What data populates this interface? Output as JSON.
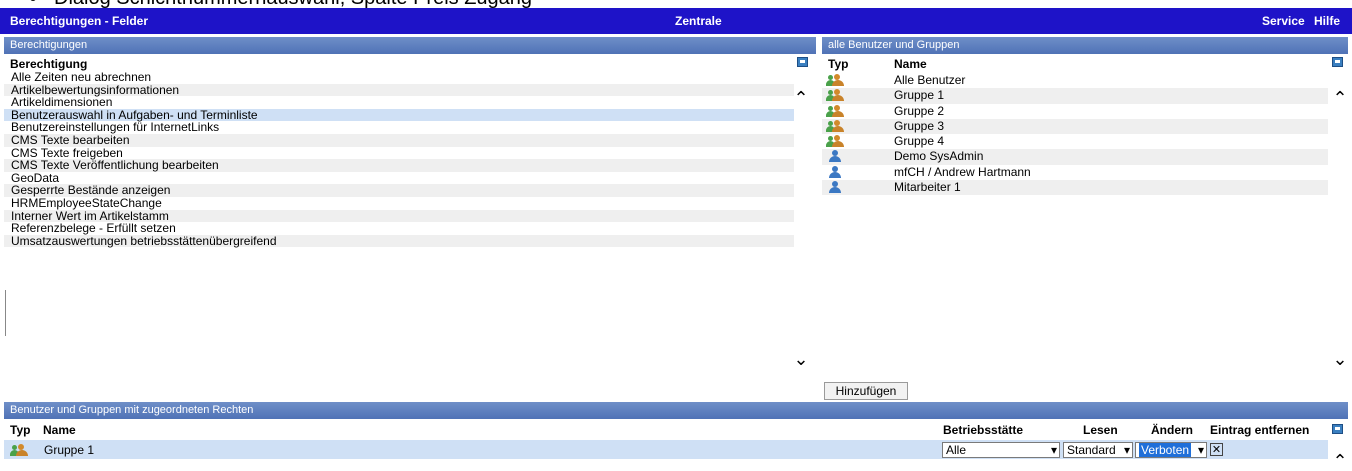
{
  "caption": "Dialog Schichtnummernauswahl, Spalte Preis Zugang",
  "titlebar": {
    "title": "Berechtigungen - Felder",
    "center": "Zentrale",
    "service": "Service",
    "help": "Hilfe"
  },
  "left_panel": {
    "section": "Berechtigungen",
    "column": "Berechtigung",
    "items": [
      "Alle Zeiten neu abrechnen",
      "Artikelbewertungsinformationen",
      "Artikeldimensionen",
      "Benutzerauswahl in Aufgaben- und Terminliste",
      "Benutzereinstellungen für InternetLinks",
      "CMS Texte bearbeiten",
      "CMS Texte freigeben",
      "CMS Texte Veröffentlichung bearbeiten",
      "GeoData",
      "Gesperrte Bestände anzeigen",
      "HRMEmployeeStateChange",
      "Interner Wert im Artikelstamm",
      "Referenzbelege - Erfüllt setzen",
      "Umsatzauswertungen betriebsstättenübergreifend"
    ],
    "selected_index": 3
  },
  "right_panel": {
    "section": "alle Benutzer und Gruppen",
    "col_type": "Typ",
    "col_name": "Name",
    "items": [
      {
        "type": "group",
        "name": "Alle Benutzer"
      },
      {
        "type": "group",
        "name": "Gruppe 1"
      },
      {
        "type": "group",
        "name": "Gruppe 2"
      },
      {
        "type": "group",
        "name": "Gruppe 3"
      },
      {
        "type": "group",
        "name": "Gruppe 4"
      },
      {
        "type": "user",
        "name": "Demo SysAdmin"
      },
      {
        "type": "user",
        "name": "mfCH / Andrew Hartmann"
      },
      {
        "type": "user",
        "name": "Mitarbeiter 1"
      }
    ],
    "add_button": "Hinzufügen"
  },
  "bottom_panel": {
    "section": "Benutzer und Gruppen mit zugeordneten Rechten",
    "col_type": "Typ",
    "col_name": "Name",
    "col_site": "Betriebsstätte",
    "col_read": "Lesen",
    "col_change": "Ändern",
    "col_remove": "Eintrag entfernen",
    "rows": [
      {
        "type": "group",
        "name": "Gruppe 1",
        "site": "Alle",
        "read": "Standard",
        "change": "Verboten",
        "remove": "✕"
      }
    ]
  },
  "icons": {
    "scroll_up": "chevron-up-icon",
    "scroll_down": "chevron-down-icon",
    "export": "export-icon",
    "user": "user-icon",
    "group": "group-icon"
  },
  "colors": {
    "titlebar": "#1e13c8",
    "section": "#5a7bbd",
    "selected_row": "#cfe0f5",
    "select_highlight": "#1f6fd9"
  }
}
